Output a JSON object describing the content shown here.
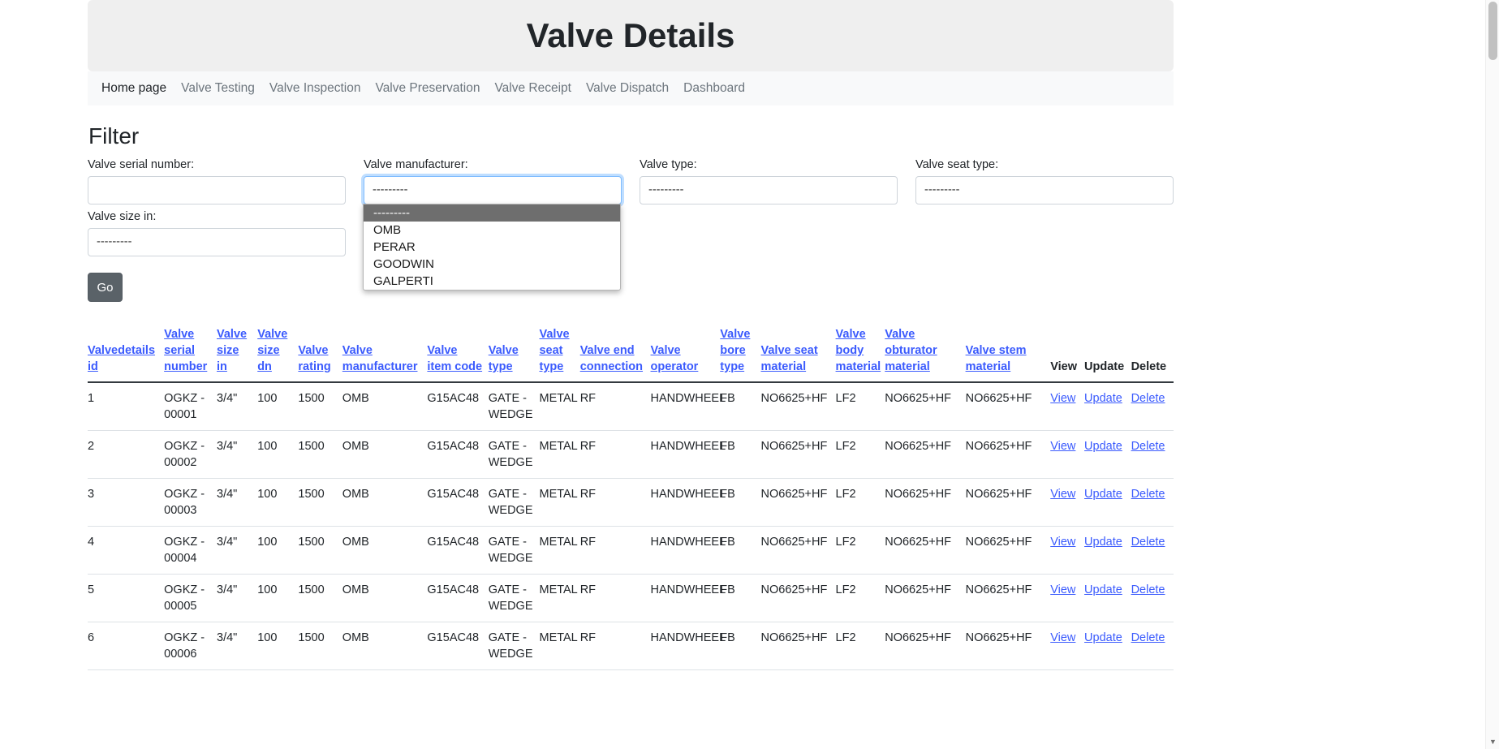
{
  "header": {
    "title": "Valve Details"
  },
  "nav": {
    "items": [
      {
        "label": "Home page",
        "active": true
      },
      {
        "label": "Valve Testing",
        "active": false
      },
      {
        "label": "Valve Inspection",
        "active": false
      },
      {
        "label": "Valve Preservation",
        "active": false
      },
      {
        "label": "Valve Receipt",
        "active": false
      },
      {
        "label": "Valve Dispatch",
        "active": false
      },
      {
        "label": "Dashboard",
        "active": false
      }
    ]
  },
  "filter": {
    "title": "Filter",
    "fields": [
      {
        "label": "Valve serial number:",
        "type": "text",
        "value": "",
        "placeholder": ""
      },
      {
        "label": "Valve manufacturer:",
        "type": "select",
        "value": "---------",
        "focused": true,
        "open": true
      },
      {
        "label": "Valve type:",
        "type": "select",
        "value": "---------",
        "focused": false,
        "open": false
      },
      {
        "label": "Valve seat type:",
        "type": "select",
        "value": "---------",
        "focused": false,
        "open": false
      },
      {
        "label": "Valve size in:",
        "type": "select",
        "value": "---------",
        "focused": false,
        "open": false
      }
    ],
    "manufacturer_options": [
      {
        "label": "---------",
        "selected": true
      },
      {
        "label": "OMB",
        "selected": false
      },
      {
        "label": "PERAR",
        "selected": false
      },
      {
        "label": "GOODWIN",
        "selected": false
      },
      {
        "label": "GALPERTI",
        "selected": false
      }
    ],
    "go_label": "Go"
  },
  "table": {
    "headers": [
      {
        "label": "Valvedetails id",
        "link": true
      },
      {
        "label": "Valve serial number",
        "link": true
      },
      {
        "label": "Valve size in",
        "link": true
      },
      {
        "label": "Valve size dn",
        "link": true
      },
      {
        "label": "Valve rating",
        "link": true
      },
      {
        "label": "Valve manufacturer",
        "link": true
      },
      {
        "label": "Valve item code",
        "link": true
      },
      {
        "label": "Valve type",
        "link": true
      },
      {
        "label": "Valve seat type",
        "link": true
      },
      {
        "label": "Valve end connection",
        "link": true
      },
      {
        "label": "Valve operator",
        "link": true
      },
      {
        "label": "Valve bore type",
        "link": true
      },
      {
        "label": "Valve seat material",
        "link": true
      },
      {
        "label": "Valve body material",
        "link": true
      },
      {
        "label": "Valve obturator material",
        "link": true
      },
      {
        "label": "Valve stem material",
        "link": true
      },
      {
        "label": "View",
        "link": false
      },
      {
        "label": "Update",
        "link": false
      },
      {
        "label": "Delete",
        "link": false
      }
    ],
    "action_labels": {
      "view": "View",
      "update": "Update",
      "delete": "Delete"
    },
    "rows": [
      [
        "1",
        "OGKZ - 00001",
        "3/4\"",
        "100",
        "1500",
        "OMB",
        "G15AC48",
        "GATE - WEDGE",
        "METAL",
        "RF",
        "HANDWHEEL",
        "FB",
        "NO6625+HF",
        "LF2",
        "NO6625+HF",
        "NO6625+HF"
      ],
      [
        "2",
        "OGKZ - 00002",
        "3/4\"",
        "100",
        "1500",
        "OMB",
        "G15AC48",
        "GATE - WEDGE",
        "METAL",
        "RF",
        "HANDWHEEL",
        "FB",
        "NO6625+HF",
        "LF2",
        "NO6625+HF",
        "NO6625+HF"
      ],
      [
        "3",
        "OGKZ - 00003",
        "3/4\"",
        "100",
        "1500",
        "OMB",
        "G15AC48",
        "GATE - WEDGE",
        "METAL",
        "RF",
        "HANDWHEEL",
        "FB",
        "NO6625+HF",
        "LF2",
        "NO6625+HF",
        "NO6625+HF"
      ],
      [
        "4",
        "OGKZ - 00004",
        "3/4\"",
        "100",
        "1500",
        "OMB",
        "G15AC48",
        "GATE - WEDGE",
        "METAL",
        "RF",
        "HANDWHEEL",
        "FB",
        "NO6625+HF",
        "LF2",
        "NO6625+HF",
        "NO6625+HF"
      ],
      [
        "5",
        "OGKZ - 00005",
        "3/4\"",
        "100",
        "1500",
        "OMB",
        "G15AC48",
        "GATE - WEDGE",
        "METAL",
        "RF",
        "HANDWHEEL",
        "FB",
        "NO6625+HF",
        "LF2",
        "NO6625+HF",
        "NO6625+HF"
      ],
      [
        "6",
        "OGKZ - 00006",
        "3/4\"",
        "100",
        "1500",
        "OMB",
        "G15AC48",
        "GATE - WEDGE",
        "METAL",
        "RF",
        "HANDWHEEL",
        "FB",
        "NO6625+HF",
        "LF2",
        "NO6625+HF",
        "NO6625+HF"
      ]
    ]
  },
  "scrollbar": {
    "up_arrow": "▲",
    "down_arrow": "▼"
  },
  "colors": {
    "link": "#3b5bfd",
    "header_bg": "#efefef",
    "nav_bg": "#f8f9fa",
    "go_btn": "#5a6268",
    "focus_ring": "#80bdff"
  }
}
